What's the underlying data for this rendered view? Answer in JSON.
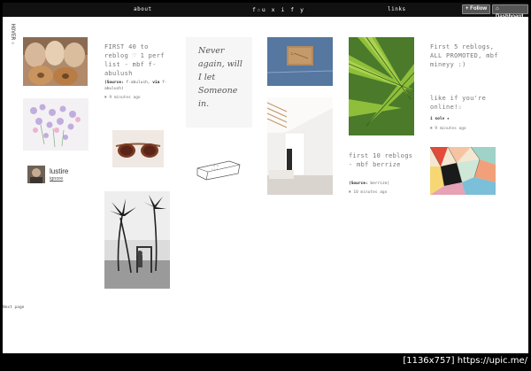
{
  "topbar": {
    "about": "about",
    "title": "f☆u x i f y",
    "links": "links",
    "follow": "+ Follow",
    "dashboard": "⌂ Dashboard"
  },
  "sidebar": {
    "label": "HOVER☆"
  },
  "posts": {
    "p1": {
      "title": "FIRST 40 to reblog ♡ 1 perf list - mbf f-abulush",
      "source_label": "(Source:",
      "source_value": "f-abulush,",
      "via_label": "via",
      "via_value": "f-abulush)",
      "time": "✖ 9 minutes ago"
    },
    "p2": {
      "title": "first 10 reblogs - mbf berrize",
      "source_label": "(Source:",
      "source_value": "berrize)",
      "time": "✖ 10 minutes ago"
    },
    "p3": {
      "title": "First 5 reblogs, ALL PROMOTED, mbf mineyy :)",
      "text": "like if you're online!☆",
      "sub": "i solv ★",
      "time": "✖ 9 minutes ago"
    }
  },
  "note_image": {
    "text": "Never again, will I let Someone in."
  },
  "follow_box": {
    "name": "lustire",
    "action": "ignore"
  },
  "footer": {
    "next_page": "Next page"
  },
  "watermark": {
    "text": "[1136x757] https://upic.me/"
  },
  "colors": {
    "topbar": "#111111",
    "background": "#ffffff",
    "title_text": "#777777"
  }
}
